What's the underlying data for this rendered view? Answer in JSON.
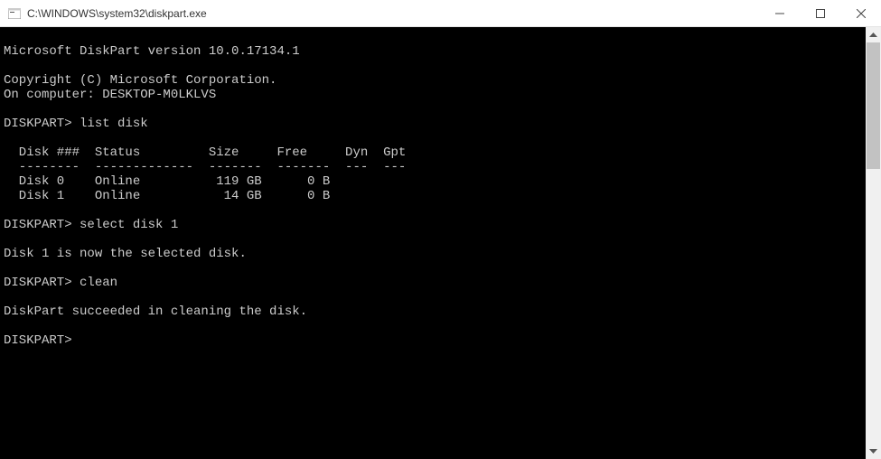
{
  "window": {
    "title": "C:\\WINDOWS\\system32\\diskpart.exe"
  },
  "terminal": {
    "version_line": "Microsoft DiskPart version 10.0.17134.1",
    "copyright_line": "Copyright (C) Microsoft Corporation.",
    "computer_line": "On computer: DESKTOP-M0LKLVS",
    "prompt": "DISKPART>",
    "commands": {
      "list_disk": "list disk",
      "select_disk": "select disk 1",
      "clean": "clean"
    },
    "disk_table": {
      "header": "  Disk ###  Status         Size     Free     Dyn  Gpt",
      "divider": "  --------  -------------  -------  -------  ---  ---",
      "rows": [
        "  Disk 0    Online          119 GB      0 B",
        "  Disk 1    Online           14 GB      0 B"
      ]
    },
    "responses": {
      "selected": "Disk 1 is now the selected disk.",
      "cleaned": "DiskPart succeeded in cleaning the disk."
    },
    "cursor": ""
  },
  "chart_data": {
    "type": "table",
    "title": "list disk",
    "columns": [
      "Disk ###",
      "Status",
      "Size",
      "Free",
      "Dyn",
      "Gpt"
    ],
    "rows": [
      {
        "Disk ###": "Disk 0",
        "Status": "Online",
        "Size": "119 GB",
        "Free": "0 B",
        "Dyn": "",
        "Gpt": ""
      },
      {
        "Disk ###": "Disk 1",
        "Status": "Online",
        "Size": "14 GB",
        "Free": "0 B",
        "Dyn": "",
        "Gpt": ""
      }
    ]
  }
}
